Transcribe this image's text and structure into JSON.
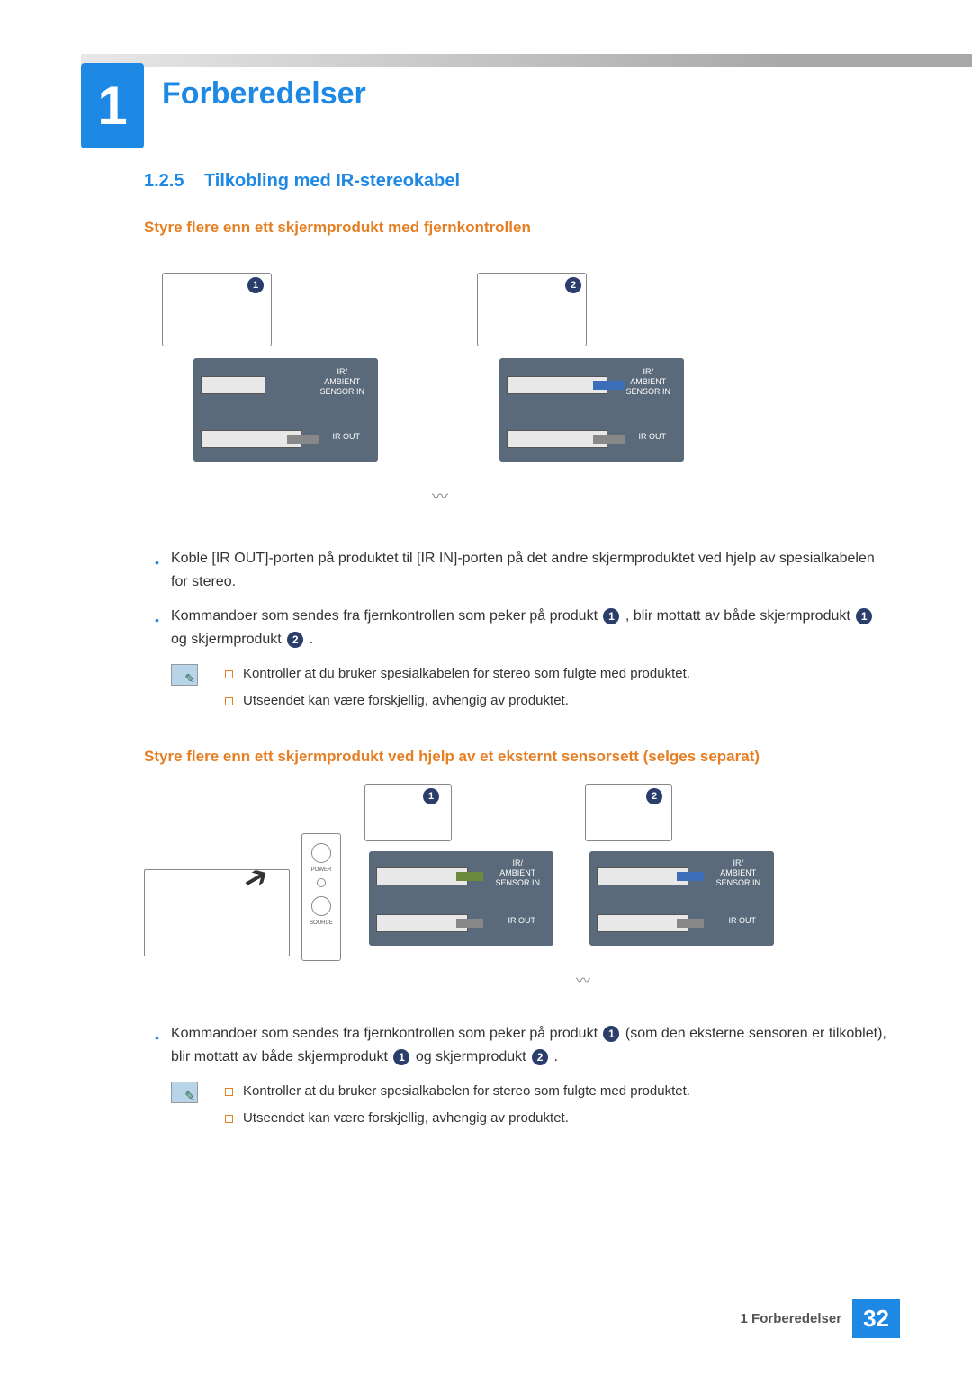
{
  "chapter": {
    "number": "1",
    "title": "Forberedelser"
  },
  "section": {
    "number": "1.2.5",
    "title": "Tilkobling med IR-stereokabel"
  },
  "sub1": {
    "heading": "Styre flere enn ett skjermprodukt med fjernkontrollen",
    "bullets": {
      "b1": "Koble [IR OUT]-porten på produktet til [IR IN]-porten på det andre skjermproduktet ved hjelp av spesialkabelen for stereo.",
      "b2a": "Kommandoer som sendes fra fjernkontrollen som peker på produkt ",
      "b2b": " , blir mottatt av både skjermprodukt ",
      "b2c": "  og skjermprodukt ",
      "b2d": " ."
    },
    "notes": {
      "n1": "Kontroller at du bruker spesialkabelen for stereo som fulgte med produktet.",
      "n2": "Utseendet kan være forskjellig, avhengig av produktet."
    }
  },
  "sub2": {
    "heading": "Styre flere enn ett skjermprodukt ved hjelp av et eksternt sensorsett (selges separat)",
    "bullets": {
      "b1a": "Kommandoer som sendes fra fjernkontrollen som peker på produkt ",
      "b1b": "  (som den eksterne sensoren er tilkoblet), blir mottatt av både skjermprodukt ",
      "b1c": "  og skjermprodukt ",
      "b1d": " ."
    },
    "notes": {
      "n1": "Kontroller at du bruker spesialkabelen for stereo som fulgte med produktet.",
      "n2": "Utseendet kan være forskjellig, avhengig av produktet."
    }
  },
  "diagram_labels": {
    "ir_ambient": "IR/\nAMBIENT\nSENSOR IN",
    "ir_out": "IR OUT",
    "power": "POWER",
    "source": "SOURCE",
    "one": "1",
    "two": "2"
  },
  "footer": {
    "text": "1 Forberedelser",
    "page": "32"
  }
}
